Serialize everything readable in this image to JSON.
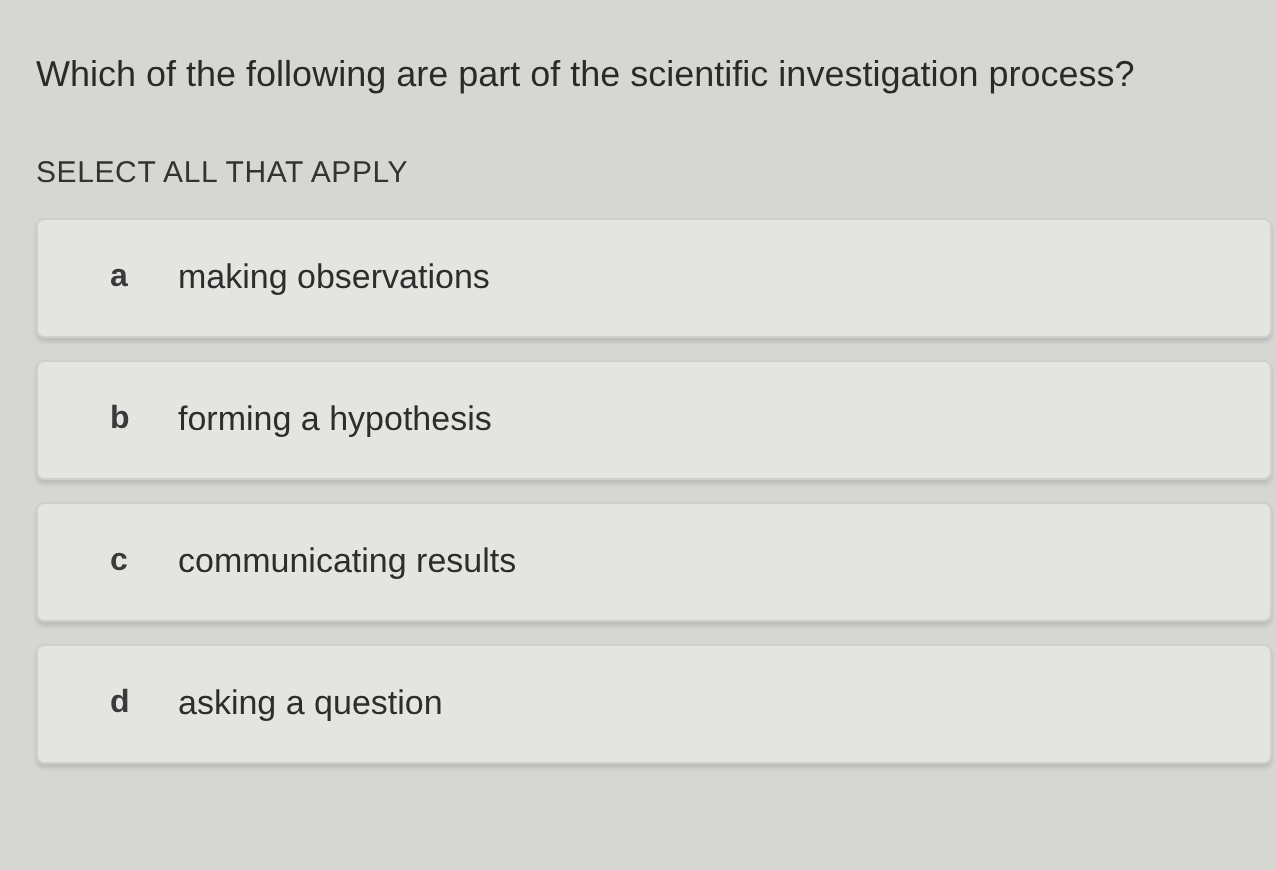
{
  "question": "Which of the following are part of the scientific investigation process?",
  "instruction": "SELECT ALL THAT APPLY",
  "options": [
    {
      "letter": "a",
      "text": "making observations",
      "selected": false
    },
    {
      "letter": "b",
      "text": "forming a hypothesis",
      "selected": false
    },
    {
      "letter": "c",
      "text": "communicating results",
      "selected": false
    },
    {
      "letter": "d",
      "text": "asking a question",
      "selected": false
    }
  ]
}
